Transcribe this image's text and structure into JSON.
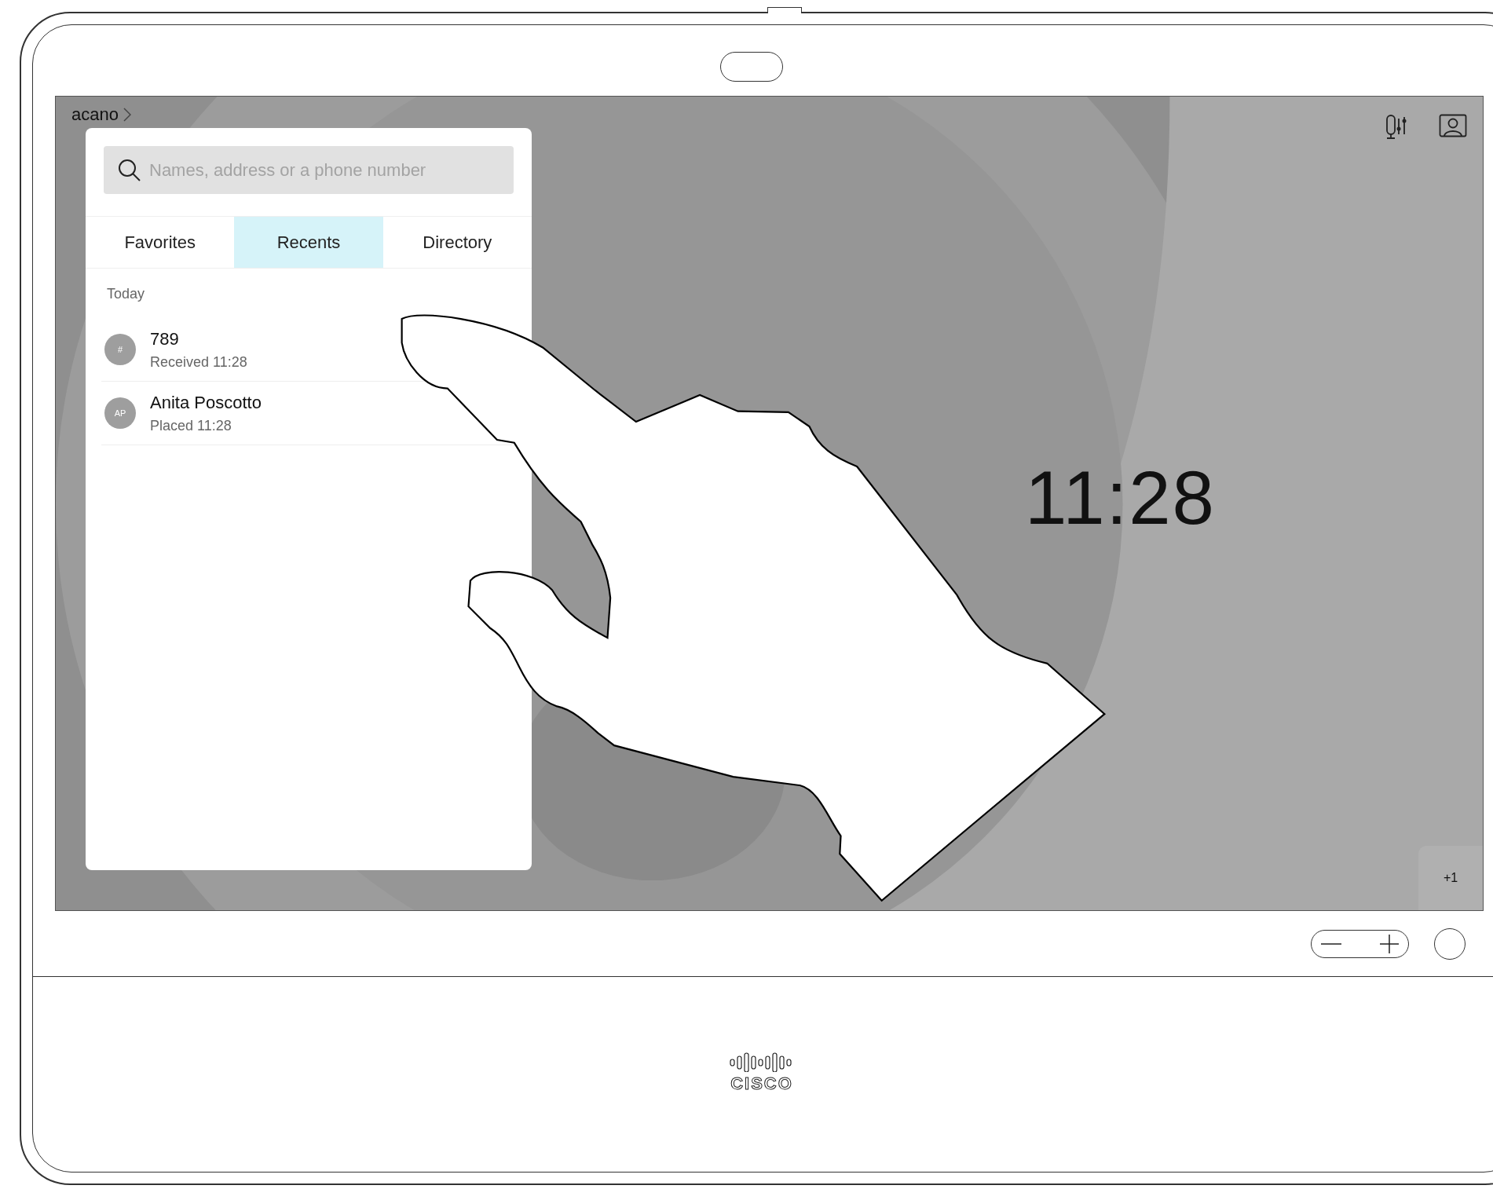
{
  "screen": {
    "breadcrumb": "acano",
    "search": {
      "placeholder": "Names, address or a phone number"
    },
    "tabs": [
      {
        "label": "Favorites",
        "selected": false
      },
      {
        "label": "Recents",
        "selected": true
      },
      {
        "label": "Directory",
        "selected": false
      }
    ],
    "section": "Today",
    "recents": [
      {
        "avatar": "#",
        "name": "789",
        "detail": "Received 11:28"
      },
      {
        "avatar": "AP",
        "name": "Anita Poscotto",
        "detail": "Placed 11:28"
      }
    ],
    "clock": "11:28",
    "participants": "+1"
  },
  "logo": "CISCO"
}
